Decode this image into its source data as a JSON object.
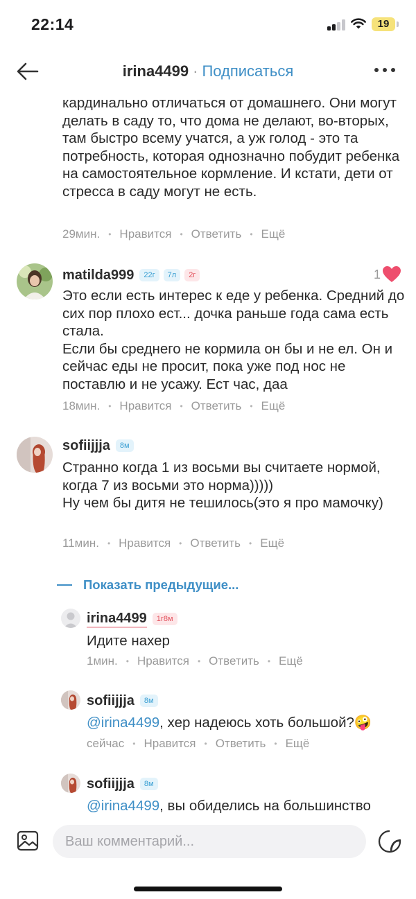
{
  "status_bar": {
    "time": "22:14",
    "battery": "19"
  },
  "header": {
    "username": "irina4499",
    "separator": "·",
    "subscribe_label": "Подписаться"
  },
  "comments": [
    {
      "id": "c1",
      "text": "кардинально отличаться от домашнего. Они могут делать в саду то, что дома не делают, во-вторых, там быстро всему учатся, а уж голод - это та потребность, которая однозначно побудит ребенка на самостоятельное кормление. И кстати, дети от стресса в саду могут не есть.",
      "time": "29мин.",
      "like_label": "Нравится",
      "reply_label": "Ответить",
      "more_label": "Ещё"
    },
    {
      "id": "c2",
      "username": "matilda999",
      "badges": [
        "22г",
        "7л",
        "2г"
      ],
      "likes": "1",
      "text": "Это если есть интерес к еде у ребенка. Средний до сих пор плохо ест... дочка раньше года сама есть стала.\nЕсли бы среднего не кормила он бы и не ел. Он и сейчас еды не просит, пока уже под нос не поставлю и не усажу. Ест час, даа",
      "time": "18мин.",
      "like_label": "Нравится",
      "reply_label": "Ответить",
      "more_label": "Ещё"
    },
    {
      "id": "c3",
      "username": "sofiijjja",
      "badges": [
        "8м"
      ],
      "text": "Странно когда 1 из восьми вы считаете нормой, когда 7 из восьми это норма)))))\nНу чем бы дитя не тешилось(это я про мамочку)",
      "time": "11мин.",
      "like_label": "Нравится",
      "reply_label": "Ответить",
      "more_label": "Ещё"
    }
  ],
  "show_previous_label": "Показать предыдущие...",
  "replies": [
    {
      "id": "r1",
      "username": "irina4499",
      "badges": [
        "1г8м"
      ],
      "text": "Идите нахер",
      "time": "1мин.",
      "like_label": "Нравится",
      "reply_label": "Ответить",
      "more_label": "Ещё"
    },
    {
      "id": "r2",
      "username": "sofiijjja",
      "badges": [
        "8м"
      ],
      "mention": "@irina4499",
      "text": ", хер надеюсь хоть большой?🤪",
      "time": "сейчас",
      "like_label": "Нравится",
      "reply_label": "Ответить",
      "more_label": "Ещё"
    },
    {
      "id": "r3",
      "username": "sofiijjja",
      "badges": [
        "8м"
      ],
      "mention": "@irina4499",
      "text": ", вы обиделись на большинство"
    }
  ],
  "input": {
    "placeholder": "Ваш комментарий..."
  },
  "colors": {
    "accent": "#3f8fc6",
    "heart": "#ee4e6d",
    "meta": "#9a9a9a"
  },
  "icons": {
    "back": "arrow-left-icon",
    "more": "ellipsis-icon",
    "image": "image-icon",
    "sticker": "sticker-icon",
    "like": "heart-icon"
  }
}
